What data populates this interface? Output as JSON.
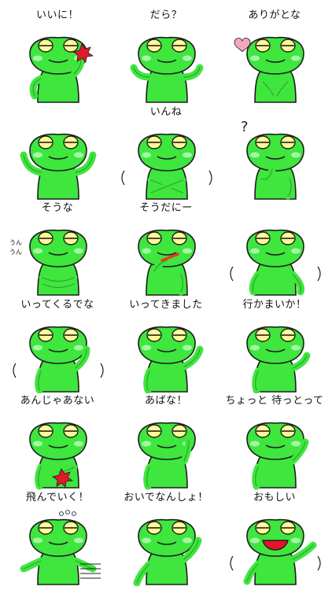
{
  "colors": {
    "frog_body": "#3ee63e",
    "frog_outline": "#1d1d1d",
    "eye_fill": "#fffb96",
    "cheek": "#a6f5a6",
    "heart": "#f3a8c0",
    "burst": "#e0192b",
    "mouth_open": "#e8122b",
    "pencil": "#e33a28"
  },
  "stickers": [
    {
      "caption": "いいに！",
      "pose": "thumb-up",
      "icon": "anger-burst-icon"
    },
    {
      "caption": "だら？",
      "pose": "shrug",
      "icon": ""
    },
    {
      "caption": "ありがとな",
      "pose": "praying-hands",
      "icon": "heart-icon"
    },
    {
      "caption": "",
      "pose": "double-thumbs-up",
      "icon": ""
    },
    {
      "caption": "いんね",
      "pose": "arms-crossed-x",
      "icon": "motion-lines-icon"
    },
    {
      "caption": "",
      "pose": "thinking",
      "icon": "question-mark-icon"
    },
    {
      "caption": "そうな",
      "pose": "arms-folded",
      "icon": "",
      "side_text": [
        "うん",
        "うん"
      ]
    },
    {
      "caption": "そうだにー",
      "pose": "holding-pencil",
      "icon": "pencil-icon"
    },
    {
      "caption": "",
      "pose": "looking-up",
      "icon": "motion-lines-icon"
    },
    {
      "caption": "いってくるでな",
      "pose": "waving",
      "icon": "motion-lines-icon"
    },
    {
      "caption": "いってきました",
      "pose": "arm-raised",
      "icon": ""
    },
    {
      "caption": "行かまいか！",
      "pose": "fist-pump",
      "icon": ""
    },
    {
      "caption": "あんじゃあない",
      "pose": "hand-on-chest",
      "icon": "anger-burst-icon"
    },
    {
      "caption": "あばな！",
      "pose": "raised-palm",
      "icon": ""
    },
    {
      "caption": "ちょっと 待っとって",
      "pose": "hand-up-stop",
      "icon": ""
    },
    {
      "caption": "飛んでいく！",
      "pose": "flying",
      "icon": "sweat-drops-icon"
    },
    {
      "caption": "おいでなんしょ！",
      "pose": "beckoning",
      "icon": ""
    },
    {
      "caption": "おもしい",
      "pose": "laughing",
      "icon": "motion-lines-icon"
    }
  ]
}
